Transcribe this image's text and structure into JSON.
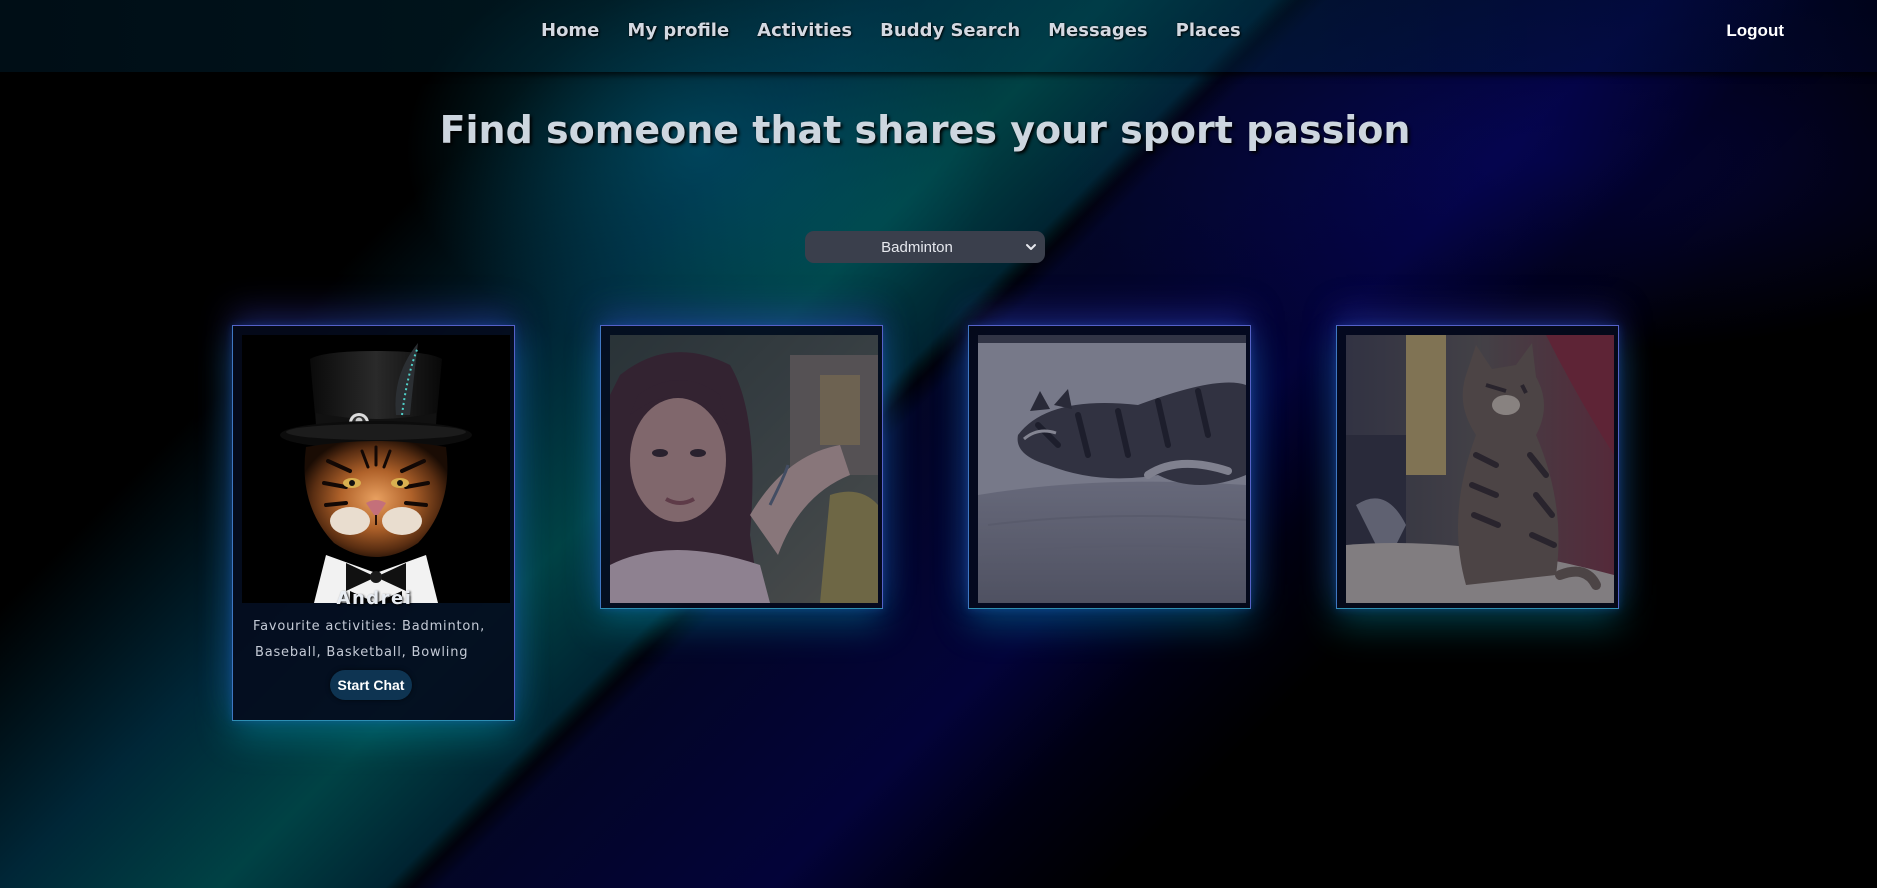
{
  "nav": {
    "items": [
      {
        "label": "Home"
      },
      {
        "label": "My profile"
      },
      {
        "label": "Activities"
      },
      {
        "label": "Buddy Search"
      },
      {
        "label": "Messages"
      },
      {
        "label": "Places"
      }
    ],
    "logout_label": "Logout"
  },
  "main": {
    "headline": "Find someone that shares your sport passion",
    "sport_filter": {
      "selected": "Badminton"
    }
  },
  "buddies": [
    {
      "photo_subject": "tiger-in-top-hat",
      "name": "Andrei",
      "activities_text": "Favourite activities: Badminton, Baseball, Basketball, Bowling",
      "chat_button_label": "Start Chat"
    },
    {
      "photo_subject": "woman-selfie-outdoors"
    },
    {
      "photo_subject": "cat-sleeping-on-bed"
    },
    {
      "photo_subject": "tabby-cat-sitting"
    }
  ],
  "colors": {
    "background": "#000000",
    "nav_text": "#d3d9e2",
    "card_border": "#5561c7",
    "card_glow_bottom": "#00c8dc",
    "select_bg": "#3a3f4c",
    "chat_button_bg": "#0e3452"
  }
}
